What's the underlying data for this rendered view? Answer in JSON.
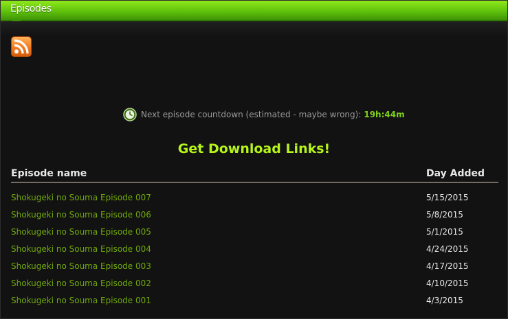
{
  "header": {
    "title": "Episodes"
  },
  "rss": {
    "icon": "rss-icon",
    "color": "#f0761a"
  },
  "countdown": {
    "icon": "clock-icon",
    "label": "Next episode countdown (estimated - maybe wrong):",
    "value": "19h:44m"
  },
  "download": {
    "label": "Get Download Links!"
  },
  "table": {
    "headers": {
      "name": "Episode name",
      "date": "Day Added"
    },
    "rows": [
      {
        "name": "Shokugeki no Souma Episode 007",
        "date": "5/15/2015"
      },
      {
        "name": "Shokugeki no Souma Episode 006",
        "date": "5/8/2015"
      },
      {
        "name": "Shokugeki no Souma Episode 005",
        "date": "5/1/2015"
      },
      {
        "name": "Shokugeki no Souma Episode 004",
        "date": "4/24/2015"
      },
      {
        "name": "Shokugeki no Souma Episode 003",
        "date": "4/17/2015"
      },
      {
        "name": "Shokugeki no Souma Episode 002",
        "date": "4/10/2015"
      },
      {
        "name": "Shokugeki no Souma Episode 001",
        "date": "4/3/2015"
      }
    ]
  },
  "colors": {
    "accent": "#7fcf1a",
    "link": "#6fa80c",
    "cta": "#b6f51a",
    "header": "#5fc20c"
  }
}
